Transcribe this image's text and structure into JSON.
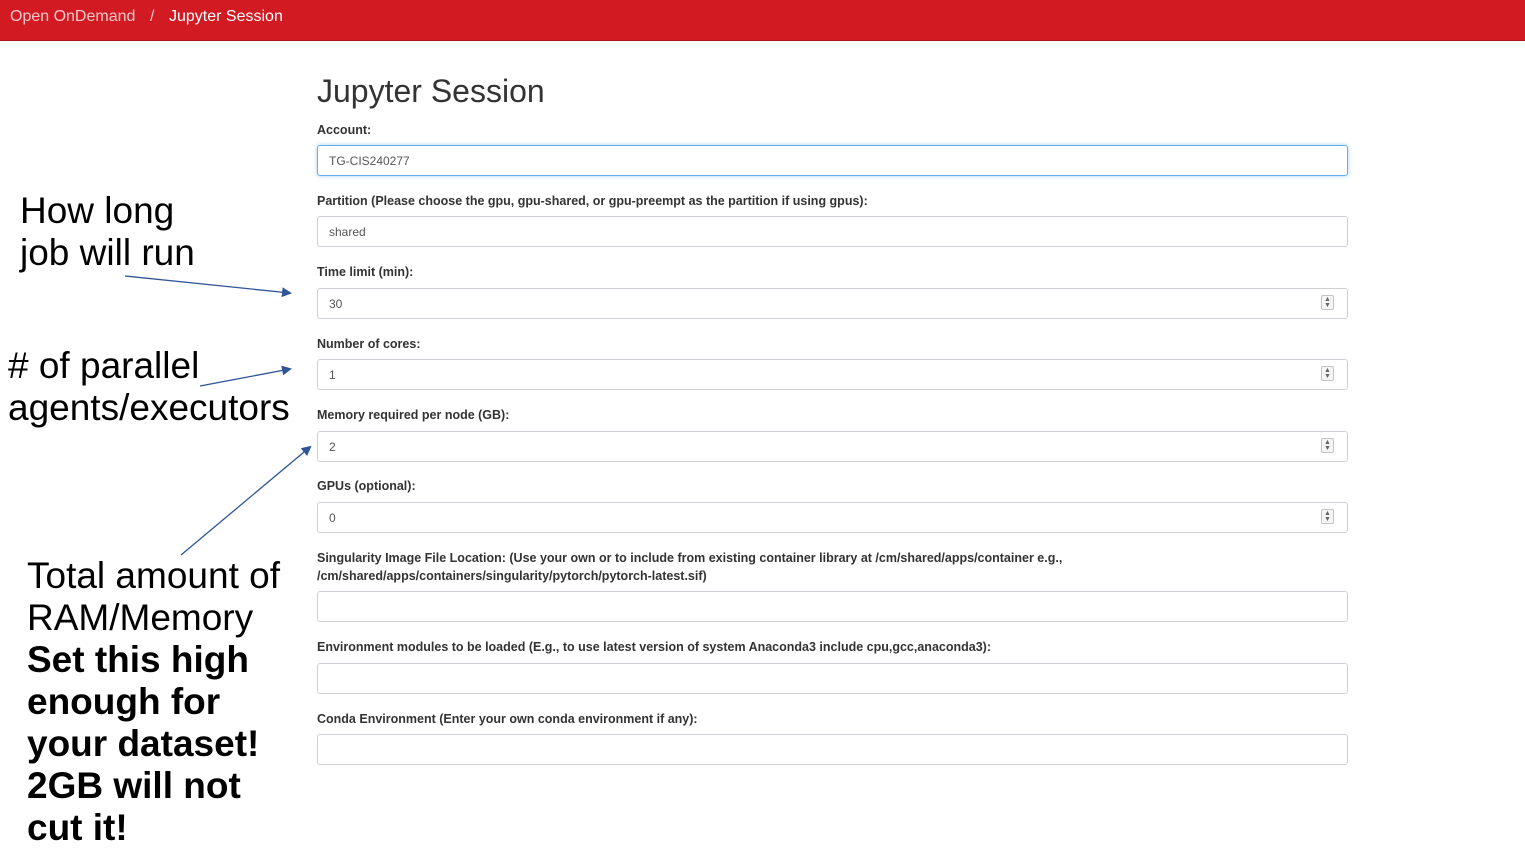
{
  "breadcrumb": {
    "home": "Open OnDemand",
    "separator": "/",
    "current": "Jupyter Session"
  },
  "page_title": "Jupyter Session",
  "form": {
    "account": {
      "label": "Account:",
      "value": "TG-CIS240277"
    },
    "partition": {
      "label": "Partition (Please choose the gpu, gpu-shared, or gpu-preempt as the partition if using gpus):",
      "value": "shared"
    },
    "time_limit": {
      "label": "Time limit (min):",
      "value": "30"
    },
    "cores": {
      "label": "Number of cores:",
      "value": "1"
    },
    "memory": {
      "label": "Memory required per node (GB):",
      "value": "2"
    },
    "gpus": {
      "label": "GPUs (optional):",
      "value": "0"
    },
    "singularity": {
      "label": "Singularity Image File Location: (Use your own or to include from existing container library at /cm/shared/apps/container e.g., /cm/shared/apps/containers/singularity/pytorch/pytorch-latest.sif)",
      "value": ""
    },
    "modules": {
      "label": "Environment modules to be loaded (E.g., to use latest version of system Anaconda3 include cpu,gcc,anaconda3):",
      "value": ""
    },
    "conda": {
      "label": "Conda Environment (Enter your own conda environment if any):",
      "value": ""
    }
  },
  "annotations": {
    "time": {
      "line1": "How long",
      "line2": "job will run"
    },
    "cores": {
      "line1": "# of parallel",
      "line2": "agents/executors"
    },
    "memory": {
      "line1": "Total amount of",
      "line2": "RAM/Memory",
      "bold1": "Set this high",
      "bold2": "enough for",
      "bold3": "your dataset!",
      "bold4": "2GB will not",
      "bold5": "cut it!"
    }
  },
  "colors": {
    "header_bg": "#d21a22",
    "arrow": "#2f5597",
    "focus_border": "#66afe9"
  },
  "icons": {
    "spinner": "up-down-spinner-icon"
  }
}
